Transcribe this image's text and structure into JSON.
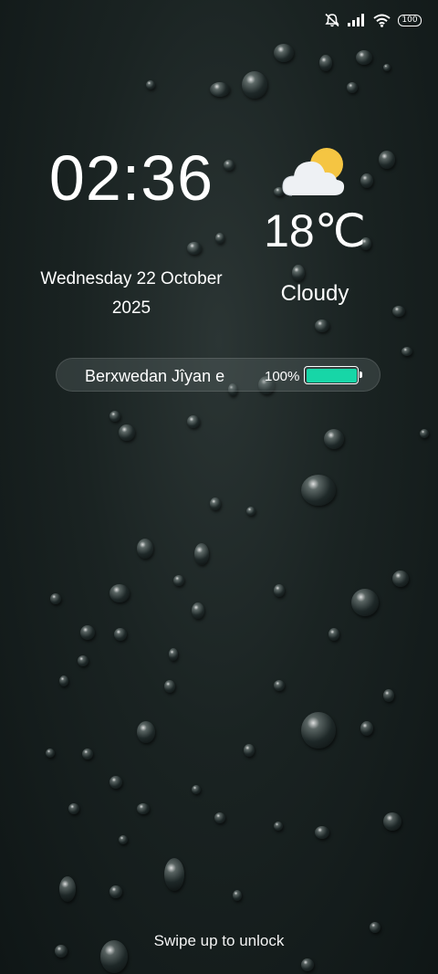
{
  "status_bar": {
    "icons": [
      "mute-icon",
      "signal-icon",
      "wifi-icon",
      "battery-icon"
    ],
    "battery_level": "100"
  },
  "clock": {
    "time": "02:36",
    "date": "Wednesday 22 October\n2025"
  },
  "weather": {
    "icon": "partly-cloudy-icon",
    "temperature": "18℃",
    "condition": "Cloudy"
  },
  "charging": {
    "label": "Berxwedan Jîyan e",
    "percent_text": "100%",
    "level": 1.0,
    "fill_color": "#17d6a7"
  },
  "footer": {
    "unlock_hint": "Swipe up to unlock"
  }
}
